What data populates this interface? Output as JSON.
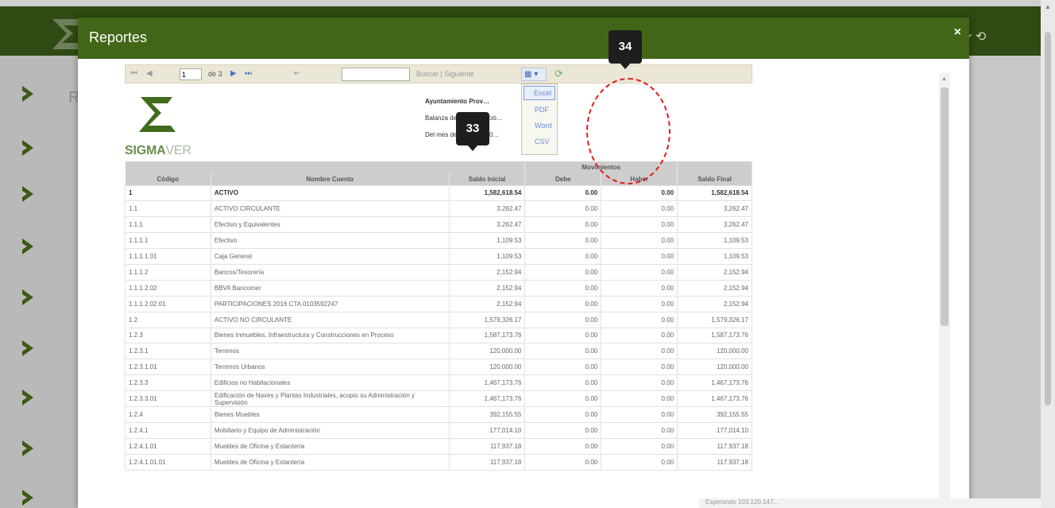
{
  "modal": {
    "title": "Reportes",
    "close_label": "×"
  },
  "background": {
    "partial_letter": "R",
    "controls": "⟳  ⟲"
  },
  "toolbar": {
    "first": "⏮",
    "prev": "◀",
    "page": "1",
    "of_label": "de 3",
    "next": "▶",
    "last": "⏭",
    "back": "⇤",
    "find_placeholder": "",
    "find_label": "Buscar",
    "next_label": "Siguiente",
    "export_icon": "save-icon",
    "refresh_icon": "refresh-icon"
  },
  "export_menu": {
    "items": [
      "Excel",
      "PDF",
      "Word",
      "CSV"
    ],
    "selected": "Excel"
  },
  "report": {
    "brand_a": "SIGMA",
    "brand_b": "VER",
    "header_lines": [
      "Ayuntamiento Prov…",
      "Balanza de Comprobació…",
      "Del mes de enero de 20…"
    ],
    "group_header": "Movimientos",
    "columns": [
      "Código",
      "Nombre Cuenta",
      "Saldo Inicial",
      "Debe",
      "Haber",
      "Saldo Final"
    ],
    "rows": [
      [
        "1",
        "ACTIVO",
        "1,582,618.54",
        "0.00",
        "0.00",
        "1,582,618.54"
      ],
      [
        "1.1",
        "ACTIVO CIRCULANTE",
        "3,262.47",
        "0.00",
        "0.00",
        "3,262.47"
      ],
      [
        "1.1.1",
        "Efectivo y Equivalentes",
        "3,262.47",
        "0.00",
        "0.00",
        "3,262.47"
      ],
      [
        "1.1.1.1",
        "Efectivo",
        "1,109.53",
        "0.00",
        "0.00",
        "1,109.53"
      ],
      [
        "1.1.1.1.01",
        "Caja General",
        "1,109.53",
        "0.00",
        "0.00",
        "1,109.53"
      ],
      [
        "1.1.1.2",
        "Bancos/Tesorería",
        "2,152.94",
        "0.00",
        "0.00",
        "2,152.94"
      ],
      [
        "1.1.1.2.02",
        "BBVA Bancomer",
        "2,152.94",
        "0.00",
        "0.00",
        "2,152.94"
      ],
      [
        "1.1.1.2.02.01",
        "PARTICIPACIONES 2016 CTA 0103592247",
        "2,152.94",
        "0.00",
        "0.00",
        "2,152.94"
      ],
      [
        "1.2",
        "ACTIVO NO CIRCULANTE",
        "1,579,326.17",
        "0.00",
        "0.00",
        "1,579,326.17"
      ],
      [
        "1.2.3",
        "Bienes Inmuebles, Infraestructura y Construcciones en Proceso",
        "1,587,173.76",
        "0.00",
        "0.00",
        "1,587,173.76"
      ],
      [
        "1.2.3.1",
        "Terrenos",
        "120,000.00",
        "0.00",
        "0.00",
        "120,000.00"
      ],
      [
        "1.2.3.1.01",
        "Terrenos Urbanos",
        "120,000.00",
        "0.00",
        "0.00",
        "120,000.00"
      ],
      [
        "1.2.3.3",
        "Edificios no Habitacionales",
        "1,467,173.76",
        "0.00",
        "0.00",
        "1,467,173.76"
      ],
      [
        "1.2.3.3.01",
        "Edificación de Naves y Plantas Industriales, acopio su Administración y Supervisión",
        "1,467,173.76",
        "0.00",
        "0.00",
        "1,467,173.76"
      ],
      [
        "1.2.4",
        "Bienes Muebles",
        "392,155.55",
        "0.00",
        "0.00",
        "392,155.55"
      ],
      [
        "1.2.4.1",
        "Mobiliario y Equipo de Administración",
        "177,014.10",
        "0.00",
        "0.00",
        "177,014.10"
      ],
      [
        "1.2.4.1.01",
        "Muebles de Oficina y Estantería",
        "117,937.18",
        "0.00",
        "0.00",
        "117,937.18"
      ],
      [
        "1.2.4.1.01.01",
        "Muebles de Oficina y Estantería",
        "117,937.18",
        "0.00",
        "0.00",
        "117,937.18"
      ]
    ]
  },
  "callouts": {
    "a": "34",
    "b": "33"
  },
  "statusbar": {
    "text": "Esperando 103.120.147..."
  }
}
